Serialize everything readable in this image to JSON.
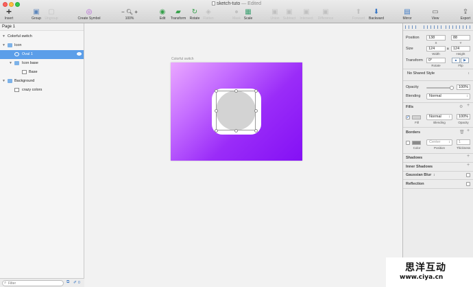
{
  "window": {
    "title": "sketch-tuto",
    "edited": "— Edited"
  },
  "toolbar": {
    "insert": "Insert",
    "group": "Group",
    "ungroup": "Ungroup",
    "create_symbol": "Create Symbol",
    "zoom": "100%",
    "edit": "Edit",
    "transform": "Transform",
    "rotate": "Rotate",
    "flatten": "Flatten",
    "mask": "Mask",
    "scale": "Scale",
    "union": "Union",
    "subtract": "Subtract",
    "intersect": "Intersect",
    "difference": "Difference",
    "forward": "Forward",
    "backward": "Backward",
    "mirror": "Mirror",
    "view": "View",
    "export": "Export"
  },
  "layers": {
    "page": "Page 1",
    "items": [
      {
        "name": "Colorful switch"
      },
      {
        "name": "Icon"
      },
      {
        "name": "Oval 1"
      },
      {
        "name": "Icon base"
      },
      {
        "name": "Base"
      },
      {
        "name": "Background"
      },
      {
        "name": "crazy colors"
      }
    ],
    "filter_placeholder": "Filter",
    "badge_count": "0"
  },
  "canvas": {
    "artboard_name": "Colorful switch",
    "colors": {
      "gradient_start": "#eaa8ff",
      "gradient_end": "#8410f5",
      "oval_fill": "#d3d3d3",
      "base_fill": "#ffffff"
    }
  },
  "inspector": {
    "position_label": "Position",
    "x_value": "138",
    "y_value": "88",
    "x_label": "X",
    "y_label": "Y",
    "size_label": "Size",
    "width_value": "124",
    "height_value": "124",
    "width_label": "Width",
    "height_label": "Height",
    "transform_label": "Transform",
    "rotate_value": "0°",
    "rotate_label": "Rotate",
    "flip_label": "Flip",
    "shared_style": "No Shared Style",
    "opacity_label": "Opacity",
    "opacity_value": "100%",
    "opacity_level": 1.0,
    "blending_label": "Blending",
    "blending_value": "Normal",
    "fills_title": "Fills",
    "fill_blending": "Normal",
    "fill_opacity": "100%",
    "fill_label": "Fill",
    "fill_blending_label": "Blending",
    "fill_opacity_label": "Opacity",
    "borders_title": "Borders",
    "border_position": "Center",
    "border_thickness": "1",
    "border_color_label": "Color",
    "border_position_label": "Position",
    "border_thickness_label": "Thickness",
    "shadows_title": "Shadows",
    "inner_shadows_title": "Inner Shadows",
    "gaussian_blur_title": "Gaussian Blur",
    "reflection_title": "Reflection"
  },
  "watermark": {
    "main": "思洋互动",
    "sub": "www.ciya.cn"
  }
}
